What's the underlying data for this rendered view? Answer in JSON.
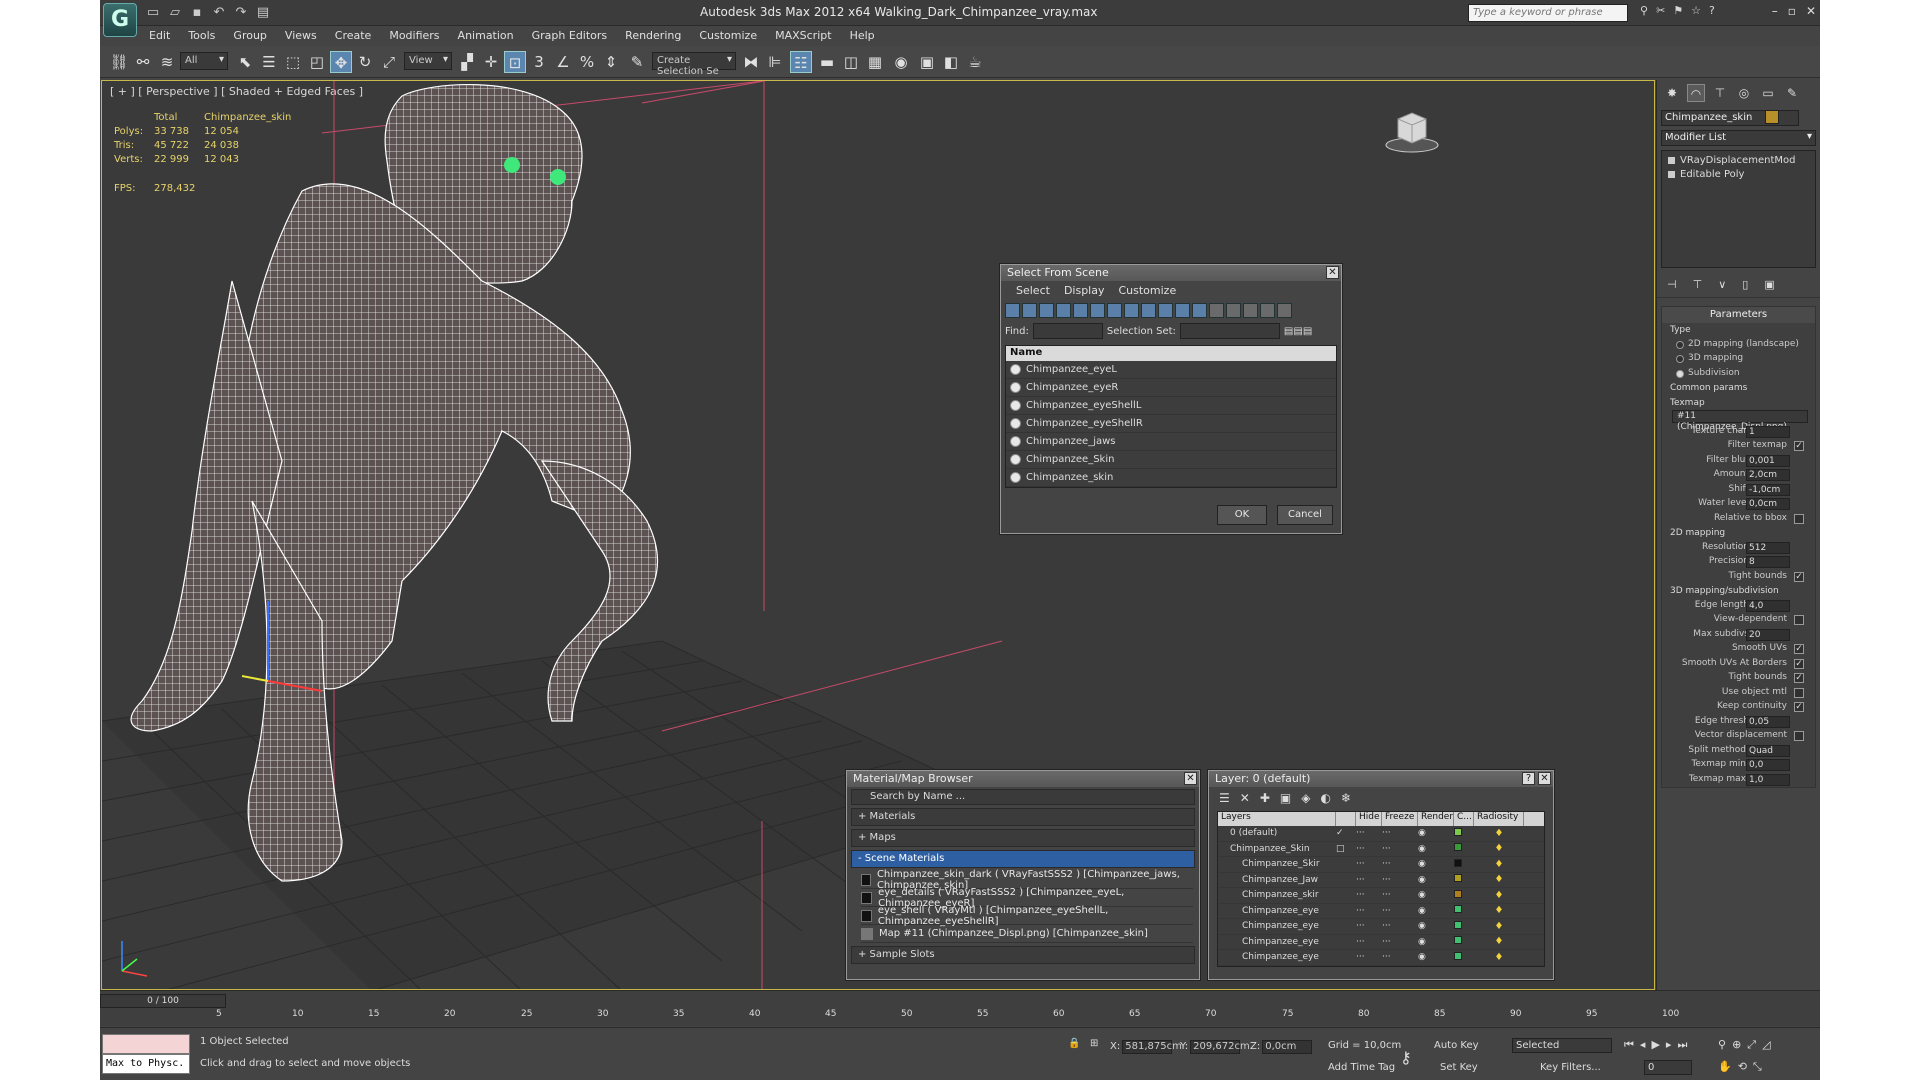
{
  "window": {
    "title": "Autodesk 3ds Max  2012 x64     Walking_Dark_Chimpanzee_vray.max",
    "search_placeholder": "Type a keyword or phrase"
  },
  "menu": [
    "Edit",
    "Tools",
    "Group",
    "Views",
    "Create",
    "Modifiers",
    "Animation",
    "Graph Editors",
    "Rendering",
    "Customize",
    "MAXScript",
    "Help"
  ],
  "toolbar": {
    "filter_value": "All",
    "coord_system": "View",
    "selection_set_placeholder": "Create Selection Se"
  },
  "viewport": {
    "label": "[ + ] [ Perspective ] [ Shaded + Edged Faces ]",
    "stats_header": [
      "",
      "Total",
      "Chimpanzee_skin"
    ],
    "stats": [
      {
        "label": "Polys:",
        "total": "33 738",
        "selected": "12 054"
      },
      {
        "label": "Tris:",
        "total": "45 722",
        "selected": "24 038"
      },
      {
        "label": "Verts:",
        "total": "22 999",
        "selected": "12 043"
      }
    ],
    "fps_label": "FPS:",
    "fps_value": "278,432",
    "mesh_color": "#ffffff",
    "eye_color": "#3fe87a",
    "grid_color": "#2a2a2a"
  },
  "select_from_scene": {
    "title": "Select From Scene",
    "menu": [
      "Select",
      "Display",
      "Customize"
    ],
    "find_label": "Find:",
    "selection_set_label": "Selection Set:",
    "column_name": "Name",
    "items": [
      "Chimpanzee_eyeL",
      "Chimpanzee_eyeR",
      "Chimpanzee_eyeShellL",
      "Chimpanzee_eyeShellR",
      "Chimpanzee_jaws",
      "Chimpanzee_Skin",
      "Chimpanzee_skin"
    ],
    "ok": "OK",
    "cancel": "Cancel"
  },
  "material_browser": {
    "title": "Material/Map Browser",
    "search_placeholder": "Search by Name ...",
    "rollouts": [
      "+ Materials",
      "+ Maps"
    ],
    "scene_rollout": "- Scene Materials",
    "scene_materials": [
      {
        "text": "Chimpanzee_skin_dark  ( VRayFastSSS2 )  [Chimpanzee_jaws, Chimpanzee_skin]",
        "icon": "material"
      },
      {
        "text": "eye_details  ( VRayFastSSS2 )  [Chimpanzee_eyeL, Chimpanzee_eyeR]",
        "icon": "material"
      },
      {
        "text": "eye_shell  ( VRayMtl )  [Chimpanzee_eyeShellL, Chimpanzee_eyeShellR]",
        "icon": "material"
      },
      {
        "text": "Map #11 (Chimpanzee_Displ.png)  [Chimpanzee_skin]",
        "icon": "map"
      }
    ],
    "sample_slots": "+ Sample Slots"
  },
  "layer_manager": {
    "title": "Layer: 0 (default)",
    "columns": [
      "Layers",
      "",
      "Hide",
      "Freeze",
      "Render",
      "C...",
      "Radiosity"
    ],
    "rows": [
      {
        "name": "0 (default)",
        "indent": 1,
        "check": "✓",
        "color": "#7ec850"
      },
      {
        "name": "Chimpanzee_Skin",
        "indent": 1,
        "check": "□",
        "color": "#3a9a3a"
      },
      {
        "name": "Chimpanzee_Skir",
        "indent": 2,
        "check": "",
        "color": "#111111"
      },
      {
        "name": "Chimpanzee_Jaw",
        "indent": 2,
        "check": "",
        "color": "#b0a020"
      },
      {
        "name": "Chimpanzee_skir",
        "indent": 2,
        "check": "",
        "color": "#b08020"
      },
      {
        "name": "Chimpanzee_eye",
        "indent": 2,
        "check": "",
        "color": "#40c070"
      },
      {
        "name": "Chimpanzee_eye",
        "indent": 2,
        "check": "",
        "color": "#40c070"
      },
      {
        "name": "Chimpanzee_eye",
        "indent": 2,
        "check": "",
        "color": "#40c070"
      },
      {
        "name": "Chimpanzee_eye",
        "indent": 2,
        "check": "",
        "color": "#40c070"
      }
    ]
  },
  "command_panel": {
    "object_name": "Chimpanzee_skin",
    "object_color": "#b8902a",
    "modifier_list": "Modifier List",
    "stack": [
      "VRayDisplacementMod",
      "Editable Poly"
    ],
    "params_title": "Parameters",
    "params": [
      {
        "type": "section",
        "label": "Type"
      },
      {
        "type": "radio",
        "label": "2D mapping (landscape)",
        "on": false
      },
      {
        "type": "radio",
        "label": "3D mapping",
        "on": false
      },
      {
        "type": "radio",
        "label": "Subdivision",
        "on": true
      },
      {
        "type": "section",
        "label": "Common params"
      },
      {
        "type": "section",
        "label": "Texmap"
      },
      {
        "type": "wide",
        "label": "#11 (Chimpanzee_Displ.png)"
      },
      {
        "type": "spin",
        "label": "Texture chan",
        "value": "1"
      },
      {
        "type": "check",
        "label": "Filter texmap",
        "value": "✓"
      },
      {
        "type": "spin",
        "label": "Filter blur",
        "value": "0,001"
      },
      {
        "type": "spin",
        "label": "Amount",
        "value": "2,0cm"
      },
      {
        "type": "spin",
        "label": "Shift",
        "value": "-1,0cm"
      },
      {
        "type": "spin",
        "label": "Water level",
        "value": "0,0cm"
      },
      {
        "type": "check",
        "label": "Relative to bbox",
        "value": ""
      },
      {
        "type": "section",
        "label": "2D mapping"
      },
      {
        "type": "spin",
        "label": "Resolution",
        "value": "512"
      },
      {
        "type": "spin",
        "label": "Precision",
        "value": "8"
      },
      {
        "type": "check",
        "label": "Tight bounds",
        "value": "✓"
      },
      {
        "type": "section",
        "label": "3D mapping/subdivision"
      },
      {
        "type": "spin",
        "label": "Edge length",
        "value": "4,0"
      },
      {
        "type": "check",
        "label": "View-dependent",
        "value": ""
      },
      {
        "type": "spin",
        "label": "Max subdivs",
        "value": "20"
      },
      {
        "type": "check",
        "label": "Smooth UVs",
        "value": "✓"
      },
      {
        "type": "check",
        "label": "Smooth UVs At Borders",
        "value": "✓"
      },
      {
        "type": "check",
        "label": "Tight bounds",
        "value": "✓"
      },
      {
        "type": "check",
        "label": "Use object mtl",
        "value": ""
      },
      {
        "type": "check",
        "label": "Keep continuity",
        "value": "✓"
      },
      {
        "type": "spin",
        "label": "Edge thresh",
        "value": "0,05"
      },
      {
        "type": "check",
        "label": "Vector displacement",
        "value": ""
      },
      {
        "type": "spin",
        "label": "Split method:",
        "value": "Quad"
      },
      {
        "type": "spin",
        "label": "Texmap min:",
        "value": "0,0"
      },
      {
        "type": "spin",
        "label": "Texmap max:",
        "value": "1,0"
      }
    ]
  },
  "timeline": {
    "slider": "0 / 100",
    "ticks": [
      "5",
      "10",
      "15",
      "20",
      "25",
      "30",
      "35",
      "40",
      "45",
      "50",
      "55",
      "60",
      "65",
      "70",
      "75",
      "80",
      "85",
      "90",
      "95",
      "100"
    ]
  },
  "status": {
    "maxscript": "Max to Physc.",
    "objects_selected": "1 Object Selected",
    "prompt": "Click and drag to select and move objects",
    "x_label": "X:",
    "x_value": "581,875cm",
    "y_label": "Y:",
    "y_value": "209,672cm",
    "z_label": "Z:",
    "z_value": "0,0cm",
    "grid": "Grid = 10,0cm",
    "add_time_tag": "Add Time Tag",
    "auto_key": "Auto Key",
    "set_key": "Set Key",
    "selected_value": "Selected",
    "key_filters": "Key Filters...",
    "frame": "0"
  }
}
